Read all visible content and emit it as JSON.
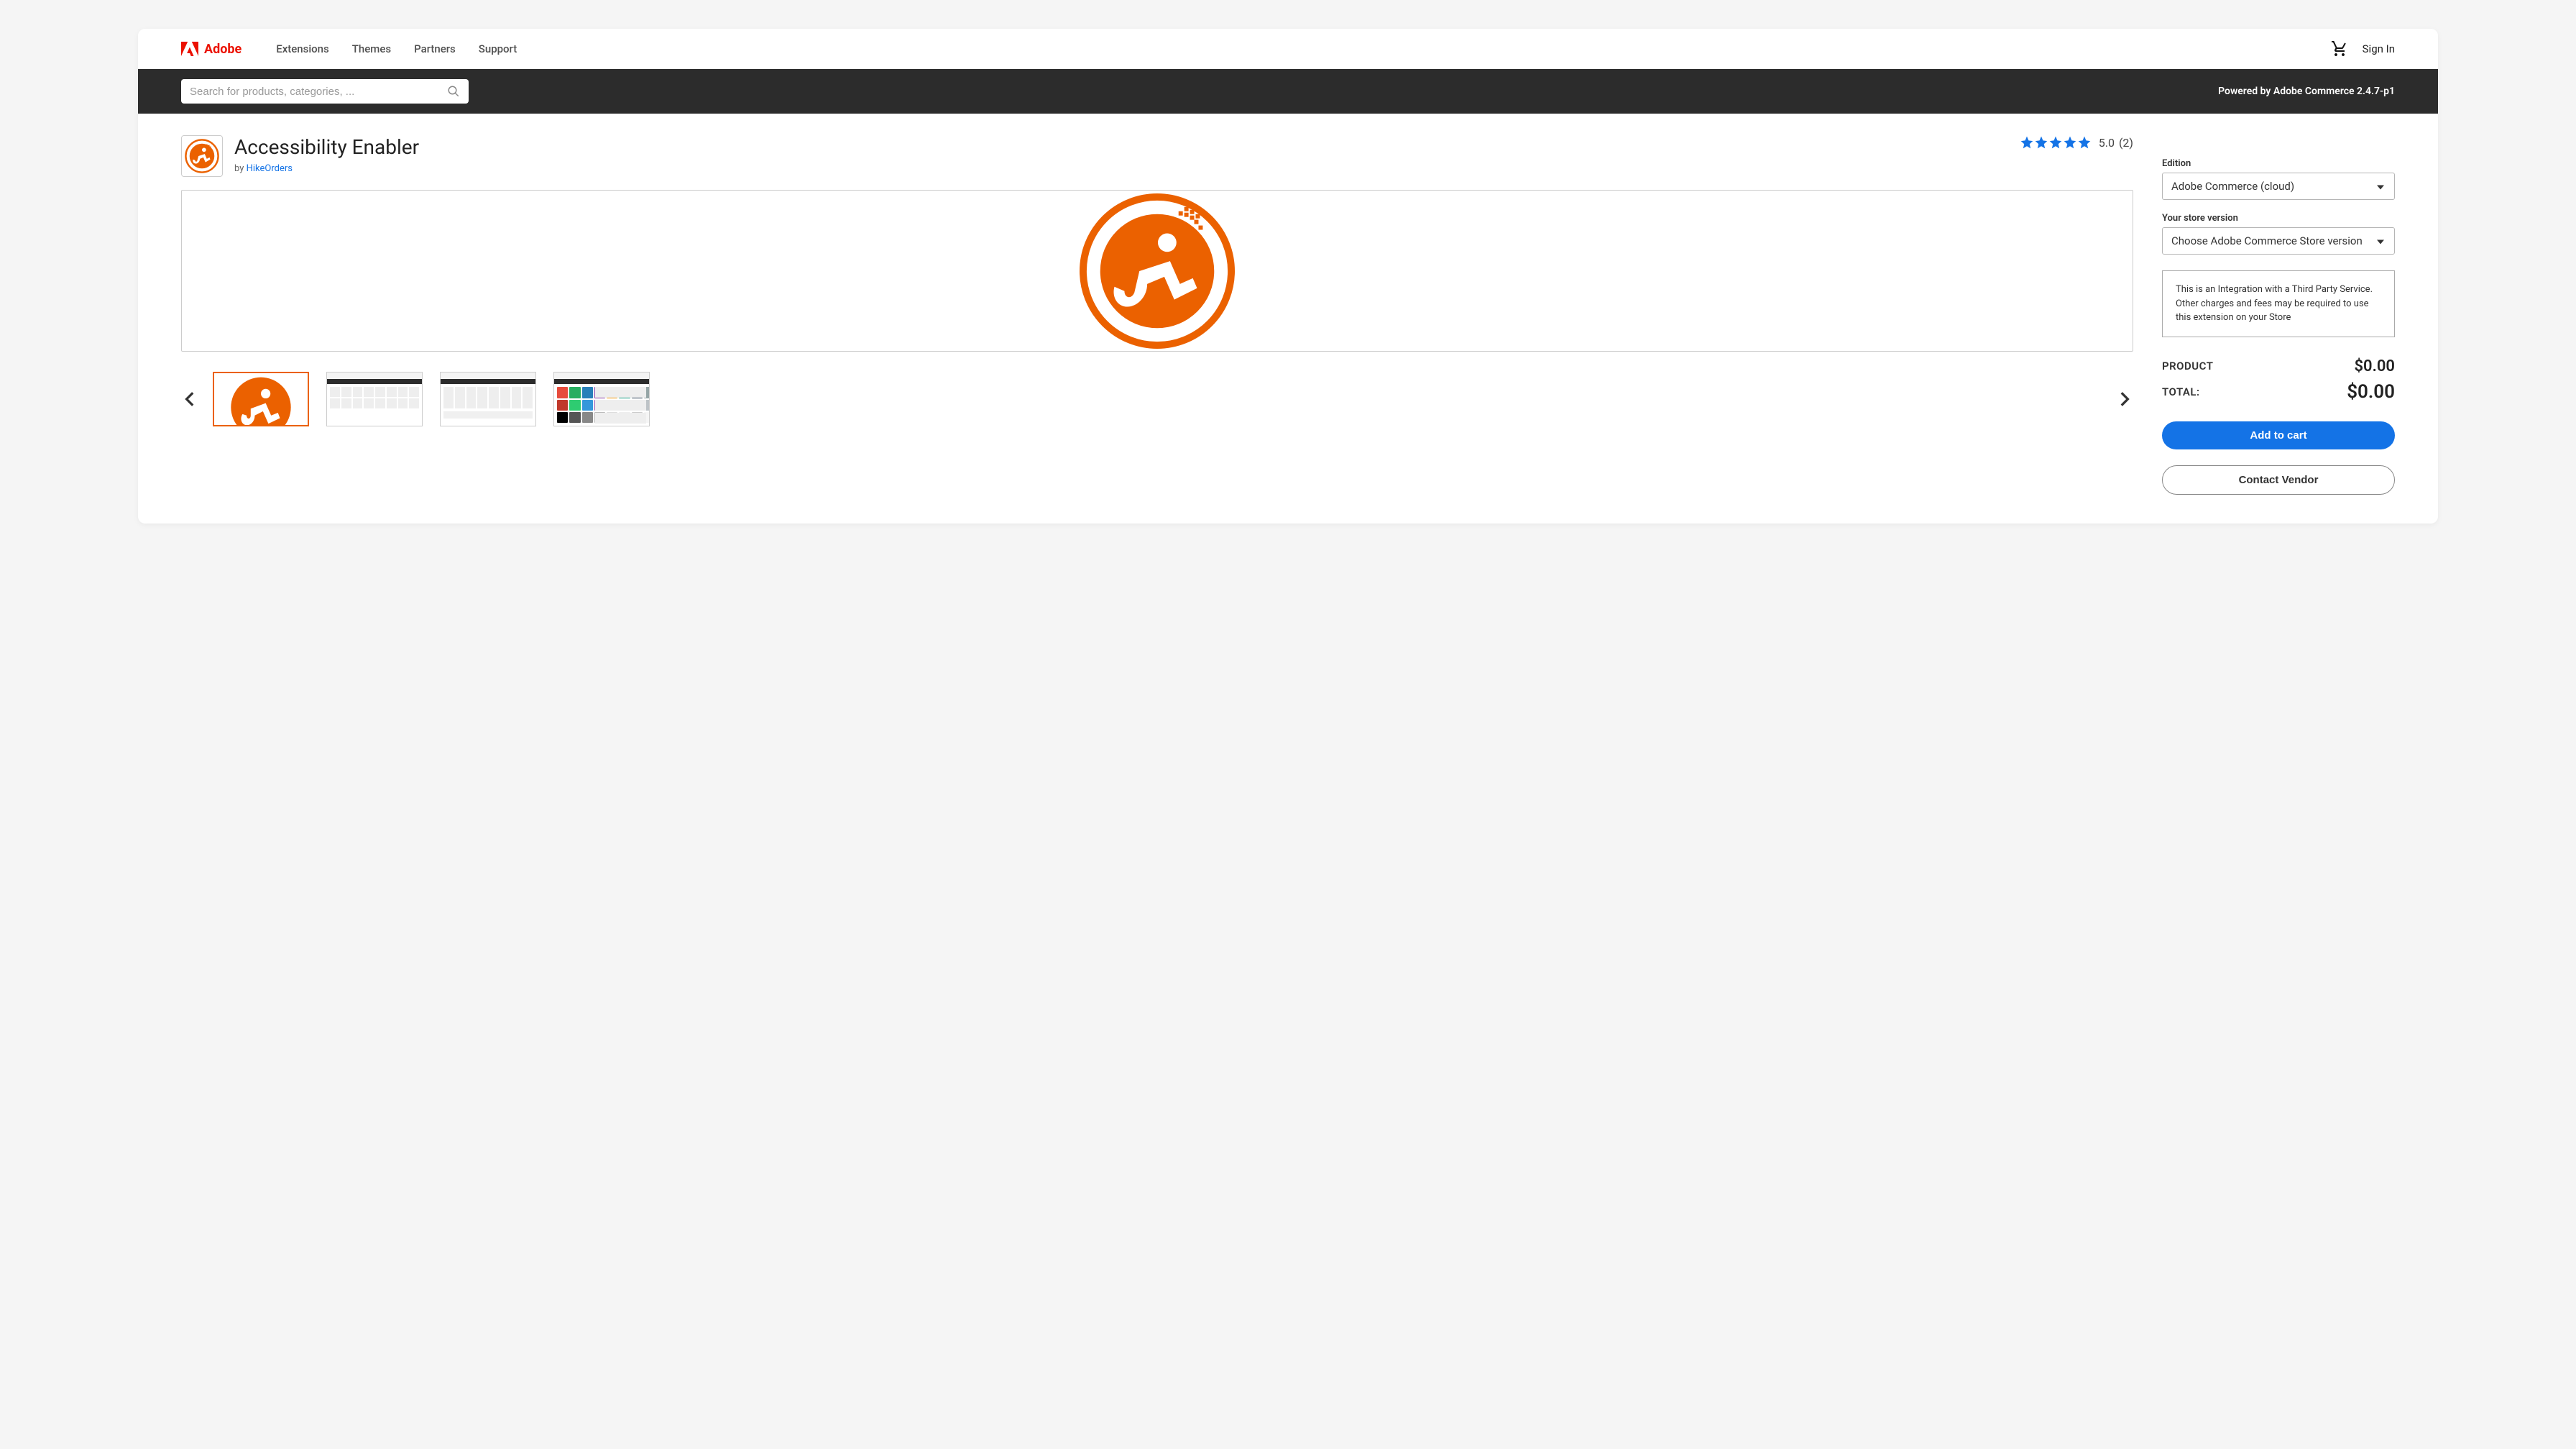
{
  "brand": {
    "text": "Adobe"
  },
  "nav": {
    "links": [
      "Extensions",
      "Themes",
      "Partners",
      "Support"
    ]
  },
  "signin": "Sign In",
  "search": {
    "placeholder": "Search for products, categories, ..."
  },
  "powered_by": "Powered by Adobe Commerce 2.4.7-p1",
  "product": {
    "title": "Accessibility Enabler",
    "by_prefix": "by ",
    "vendor": "HikeOrders",
    "rating": "5.0",
    "rating_count": "(2)"
  },
  "sidebar": {
    "edition_label": "Edition",
    "edition_value": "Adobe Commerce (cloud)",
    "version_label": "Your store version",
    "version_value": "Choose Adobe Commerce Store version",
    "notice": "This is an Integration with a Third Party Service. Other charges and fees may be required to use this extension on your Store",
    "product_label": "PRODUCT",
    "product_price": "$0.00",
    "total_label": "TOTAL:",
    "total_price": "$0.00",
    "add_to_cart": "Add to cart",
    "contact_vendor": "Contact Vendor"
  }
}
